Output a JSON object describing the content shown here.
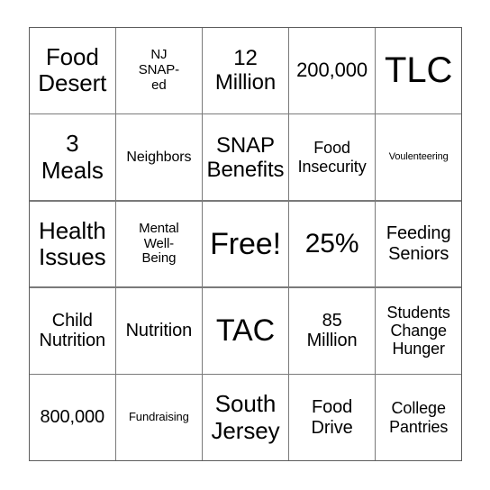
{
  "card": {
    "type": "bingo-card",
    "rows": 5,
    "columns": 5,
    "free_space_index": 12,
    "colors": {
      "cell_background": "#ffffff",
      "grid_line": "#7a7a7a",
      "text": "#000000",
      "page_background": "#ffffff"
    },
    "cells": [
      {
        "text": "Food\nDesert",
        "size": "fs-h1"
      },
      {
        "text": "NJ\nSNAP-\ned",
        "size": "fs-sm"
      },
      {
        "text": "12\nMillion",
        "size": "fs-xxl"
      },
      {
        "text": "200,000",
        "size": "fs-xl"
      },
      {
        "text": "TLC",
        "size": "fs-h5"
      },
      {
        "text": "3\nMeals",
        "size": "fs-h1"
      },
      {
        "text": "Neighbors",
        "size": "fs-smm"
      },
      {
        "text": "SNAP\nBenefits",
        "size": "fs-xxl"
      },
      {
        "text": "Food\nInsecurity",
        "size": "fs-md"
      },
      {
        "text": "Voulenteering",
        "size": "fs-xxs"
      },
      {
        "text": "Health\nIssues",
        "size": "fs-h1"
      },
      {
        "text": "Mental\nWell-\nBeing",
        "size": "fs-sm"
      },
      {
        "text": "Free!",
        "size": "fs-h4"
      },
      {
        "text": "25%",
        "size": "fs-h3"
      },
      {
        "text": "Feeding\nSeniors",
        "size": "fs-lg"
      },
      {
        "text": "Child\nNutrition",
        "size": "fs-lg"
      },
      {
        "text": "Nutrition",
        "size": "fs-lg"
      },
      {
        "text": "TAC",
        "size": "fs-h4"
      },
      {
        "text": "85\nMillion",
        "size": "fs-lg"
      },
      {
        "text": "Students\nChange\nHunger",
        "size": "fs-md"
      },
      {
        "text": "800,000",
        "size": "fs-lg"
      },
      {
        "text": "Fundraising",
        "size": "fs-xs"
      },
      {
        "text": "South\nJersey",
        "size": "fs-h1"
      },
      {
        "text": "Food\nDrive",
        "size": "fs-lg"
      },
      {
        "text": "College\nPantries",
        "size": "fs-md"
      }
    ]
  }
}
